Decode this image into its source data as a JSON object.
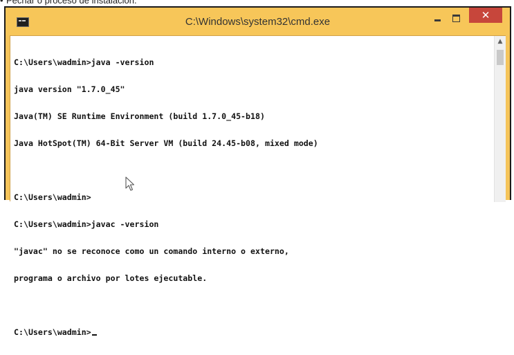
{
  "caption": {
    "bullet": "•",
    "text": "Pechar o proceso de instalación."
  },
  "window": {
    "title": "C:\\Windows\\system32\\cmd.exe",
    "icon": "console-icon",
    "controls": {
      "minimize_icon": "minimize-icon",
      "maximize_icon": "maximize-icon",
      "close_glyph": "✕"
    },
    "colors": {
      "titlebar": "#f7c659",
      "close_button": "#c7463b",
      "console_background": "#ffffff",
      "console_text": "#111111"
    }
  },
  "console": {
    "lines": [
      "C:\\Users\\wadmin>java -version",
      "java version \"1.7.0_45\"",
      "Java(TM) SE Runtime Environment (build 1.7.0_45-b18)",
      "Java HotSpot(TM) 64-Bit Server VM (build 24.45-b08, mixed mode)",
      "",
      "C:\\Users\\wadmin>",
      "C:\\Users\\wadmin>javac -version",
      "\"javac\" no se reconoce como un comando interno o externo,",
      "programa o archivo por lotes ejecutable.",
      "",
      "C:\\Users\\wadmin>"
    ]
  },
  "scrollbar": {
    "up_arrow_glyph": "▲"
  }
}
